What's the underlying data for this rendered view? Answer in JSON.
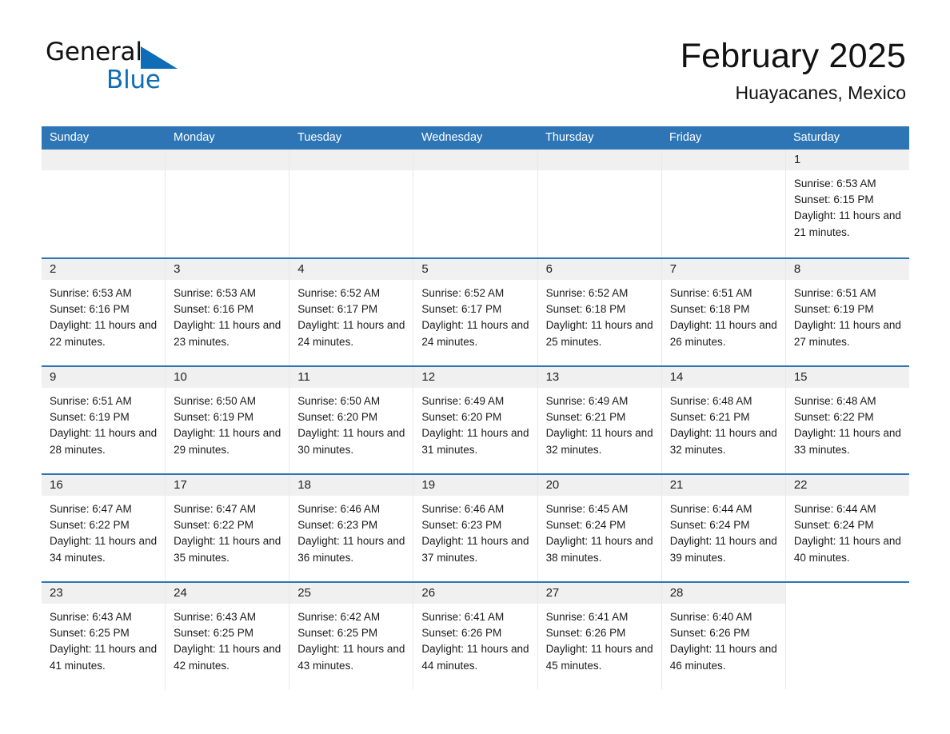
{
  "brand": {
    "word1": "General",
    "word2": "Blue",
    "accent_color": "#0f6cb6",
    "triangle_icon": "triangle-logo-icon"
  },
  "header": {
    "month_title": "February 2025",
    "location": "Huayacanes, Mexico"
  },
  "theme": {
    "header_blue": "#2e75b6",
    "day_band_gray": "#f0f0f0",
    "grid_line": "#e8e8e8"
  },
  "calendar": {
    "weekday_labels": [
      "Sunday",
      "Monday",
      "Tuesday",
      "Wednesday",
      "Thursday",
      "Friday",
      "Saturday"
    ],
    "labels": {
      "sunrise_prefix": "Sunrise:",
      "sunset_prefix": "Sunset:",
      "daylight_prefix": "Daylight:"
    },
    "weeks": [
      [
        {
          "day": "",
          "empty": true
        },
        {
          "day": "",
          "empty": true
        },
        {
          "day": "",
          "empty": true
        },
        {
          "day": "",
          "empty": true
        },
        {
          "day": "",
          "empty": true
        },
        {
          "day": "",
          "empty": true
        },
        {
          "day": "1",
          "sunrise": "Sunrise: 6:53 AM",
          "sunset": "Sunset: 6:15 PM",
          "daylight": "Daylight: 11 hours and 21 minutes."
        }
      ],
      [
        {
          "day": "2",
          "sunrise": "Sunrise: 6:53 AM",
          "sunset": "Sunset: 6:16 PM",
          "daylight": "Daylight: 11 hours and 22 minutes."
        },
        {
          "day": "3",
          "sunrise": "Sunrise: 6:53 AM",
          "sunset": "Sunset: 6:16 PM",
          "daylight": "Daylight: 11 hours and 23 minutes."
        },
        {
          "day": "4",
          "sunrise": "Sunrise: 6:52 AM",
          "sunset": "Sunset: 6:17 PM",
          "daylight": "Daylight: 11 hours and 24 minutes."
        },
        {
          "day": "5",
          "sunrise": "Sunrise: 6:52 AM",
          "sunset": "Sunset: 6:17 PM",
          "daylight": "Daylight: 11 hours and 24 minutes."
        },
        {
          "day": "6",
          "sunrise": "Sunrise: 6:52 AM",
          "sunset": "Sunset: 6:18 PM",
          "daylight": "Daylight: 11 hours and 25 minutes."
        },
        {
          "day": "7",
          "sunrise": "Sunrise: 6:51 AM",
          "sunset": "Sunset: 6:18 PM",
          "daylight": "Daylight: 11 hours and 26 minutes."
        },
        {
          "day": "8",
          "sunrise": "Sunrise: 6:51 AM",
          "sunset": "Sunset: 6:19 PM",
          "daylight": "Daylight: 11 hours and 27 minutes."
        }
      ],
      [
        {
          "day": "9",
          "sunrise": "Sunrise: 6:51 AM",
          "sunset": "Sunset: 6:19 PM",
          "daylight": "Daylight: 11 hours and 28 minutes."
        },
        {
          "day": "10",
          "sunrise": "Sunrise: 6:50 AM",
          "sunset": "Sunset: 6:19 PM",
          "daylight": "Daylight: 11 hours and 29 minutes."
        },
        {
          "day": "11",
          "sunrise": "Sunrise: 6:50 AM",
          "sunset": "Sunset: 6:20 PM",
          "daylight": "Daylight: 11 hours and 30 minutes."
        },
        {
          "day": "12",
          "sunrise": "Sunrise: 6:49 AM",
          "sunset": "Sunset: 6:20 PM",
          "daylight": "Daylight: 11 hours and 31 minutes."
        },
        {
          "day": "13",
          "sunrise": "Sunrise: 6:49 AM",
          "sunset": "Sunset: 6:21 PM",
          "daylight": "Daylight: 11 hours and 32 minutes."
        },
        {
          "day": "14",
          "sunrise": "Sunrise: 6:48 AM",
          "sunset": "Sunset: 6:21 PM",
          "daylight": "Daylight: 11 hours and 32 minutes."
        },
        {
          "day": "15",
          "sunrise": "Sunrise: 6:48 AM",
          "sunset": "Sunset: 6:22 PM",
          "daylight": "Daylight: 11 hours and 33 minutes."
        }
      ],
      [
        {
          "day": "16",
          "sunrise": "Sunrise: 6:47 AM",
          "sunset": "Sunset: 6:22 PM",
          "daylight": "Daylight: 11 hours and 34 minutes."
        },
        {
          "day": "17",
          "sunrise": "Sunrise: 6:47 AM",
          "sunset": "Sunset: 6:22 PM",
          "daylight": "Daylight: 11 hours and 35 minutes."
        },
        {
          "day": "18",
          "sunrise": "Sunrise: 6:46 AM",
          "sunset": "Sunset: 6:23 PM",
          "daylight": "Daylight: 11 hours and 36 minutes."
        },
        {
          "day": "19",
          "sunrise": "Sunrise: 6:46 AM",
          "sunset": "Sunset: 6:23 PM",
          "daylight": "Daylight: 11 hours and 37 minutes."
        },
        {
          "day": "20",
          "sunrise": "Sunrise: 6:45 AM",
          "sunset": "Sunset: 6:24 PM",
          "daylight": "Daylight: 11 hours and 38 minutes."
        },
        {
          "day": "21",
          "sunrise": "Sunrise: 6:44 AM",
          "sunset": "Sunset: 6:24 PM",
          "daylight": "Daylight: 11 hours and 39 minutes."
        },
        {
          "day": "22",
          "sunrise": "Sunrise: 6:44 AM",
          "sunset": "Sunset: 6:24 PM",
          "daylight": "Daylight: 11 hours and 40 minutes."
        }
      ],
      [
        {
          "day": "23",
          "sunrise": "Sunrise: 6:43 AM",
          "sunset": "Sunset: 6:25 PM",
          "daylight": "Daylight: 11 hours and 41 minutes."
        },
        {
          "day": "24",
          "sunrise": "Sunrise: 6:43 AM",
          "sunset": "Sunset: 6:25 PM",
          "daylight": "Daylight: 11 hours and 42 minutes."
        },
        {
          "day": "25",
          "sunrise": "Sunrise: 6:42 AM",
          "sunset": "Sunset: 6:25 PM",
          "daylight": "Daylight: 11 hours and 43 minutes."
        },
        {
          "day": "26",
          "sunrise": "Sunrise: 6:41 AM",
          "sunset": "Sunset: 6:26 PM",
          "daylight": "Daylight: 11 hours and 44 minutes."
        },
        {
          "day": "27",
          "sunrise": "Sunrise: 6:41 AM",
          "sunset": "Sunset: 6:26 PM",
          "daylight": "Daylight: 11 hours and 45 minutes."
        },
        {
          "day": "28",
          "sunrise": "Sunrise: 6:40 AM",
          "sunset": "Sunset: 6:26 PM",
          "daylight": "Daylight: 11 hours and 46 minutes."
        },
        {
          "day": "",
          "empty": true,
          "trailing": true
        }
      ]
    ]
  }
}
